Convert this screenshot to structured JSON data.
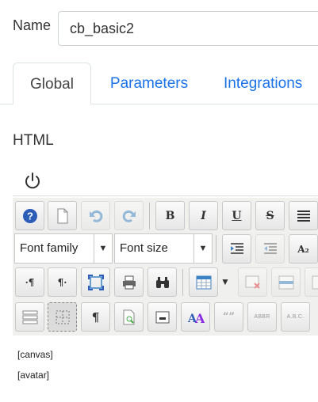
{
  "form": {
    "name_label": "Name",
    "name_value": "cb_basic2"
  },
  "tabs": [
    {
      "label": "Global",
      "active": true
    },
    {
      "label": "Parameters",
      "active": false
    },
    {
      "label": "Integrations",
      "active": false
    }
  ],
  "section": {
    "title": "HTML"
  },
  "editor": {
    "font_family": "Font family",
    "font_size": "Font size",
    "glyphs": {
      "bold": "B",
      "italic": "I",
      "underline": "U",
      "strike": "S",
      "subscript": "A₂",
      "paragraph": "¶",
      "ltr": "·¶",
      "rtl": "¶·",
      "abbr": "ABBR",
      "acronym": "A.B.C.",
      "quote": "“”"
    },
    "content_lines": [
      "[canvas]",
      "[avatar]"
    ]
  },
  "colors": {
    "accent": "#1a73e8",
    "help_blue": "#2b5cb8",
    "toolbar_bg": "#f0f0ee"
  }
}
